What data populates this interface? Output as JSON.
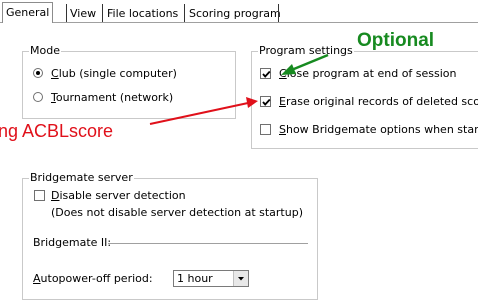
{
  "tabs": [
    {
      "label": "General"
    },
    {
      "label": "View"
    },
    {
      "label": "File locations"
    },
    {
      "label": "Scoring program"
    }
  ],
  "mode": {
    "title": "Mode",
    "club_label": "Club (single computer)",
    "tournament_label": "Tournament (network)",
    "selected": "club"
  },
  "program_settings": {
    "title": "Program settings",
    "close_label": "Close program at end of session",
    "close_checked": true,
    "erase_label": "Erase original records of deleted scores",
    "erase_checked": true,
    "bridgemate_opts_label": "Show Bridgemate options when starting",
    "bridgemate_opts_checked": false
  },
  "bridgemate_server": {
    "title": "Bridgemate server",
    "disable_label": "Disable server detection",
    "disable_checked": false,
    "note": "(Does not disable server detection at startup)"
  },
  "bridgemate_ii": {
    "title": "Bridgemate II:",
    "autopower_label": "Autopower-off period:",
    "autopower_value": "1 hour"
  },
  "annotations": {
    "optional": "Optional",
    "acbl": "sing ACBLscore",
    "optional_color": "#178a20",
    "acbl_color": "#e0101a"
  }
}
